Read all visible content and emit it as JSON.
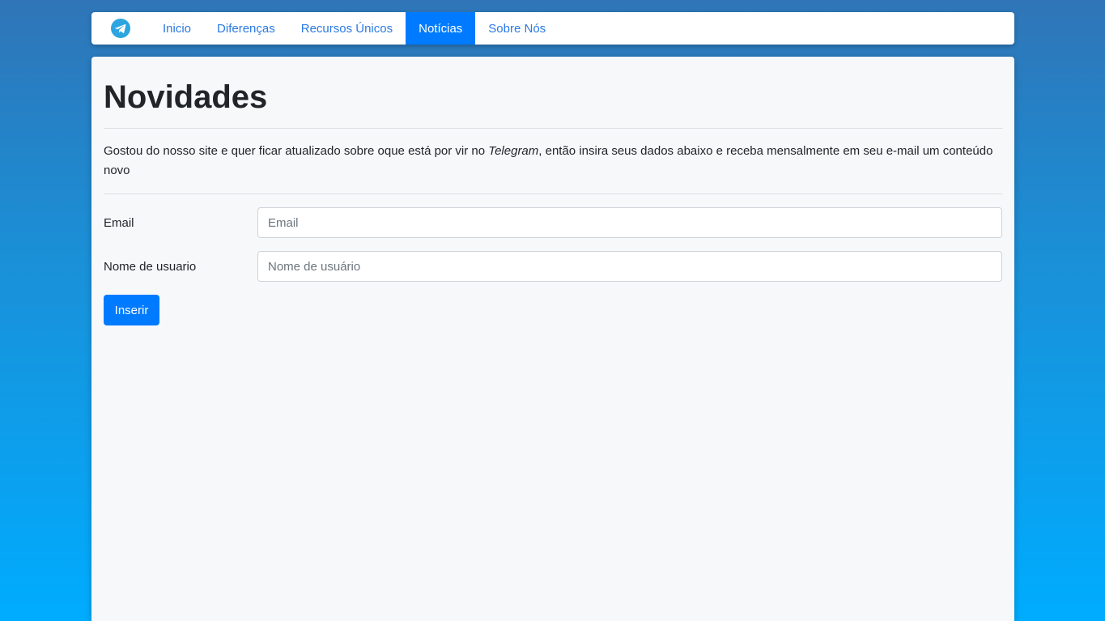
{
  "nav": {
    "brand_icon": "telegram-icon",
    "items": [
      {
        "label": "Inicio",
        "active": false
      },
      {
        "label": "Diferenças",
        "active": false
      },
      {
        "label": "Recursos Únicos",
        "active": false
      },
      {
        "label": "Notícias",
        "active": true
      },
      {
        "label": "Sobre Nós",
        "active": false
      }
    ]
  },
  "main": {
    "title": "Novidades",
    "intro_before": "Gostou do nosso site e quer ficar atualizado sobre oque está por vir no ",
    "intro_emphasis": "Telegram",
    "intro_after": ", então insira seus dados abaixo e receba mensalmente em seu e-mail um conteúdo novo"
  },
  "form": {
    "email_label": "Email",
    "email_placeholder": "Email",
    "email_value": "",
    "username_label": "Nome de usuario",
    "username_placeholder": "Nome de usuário",
    "username_value": "",
    "submit_label": "Inserir"
  },
  "colors": {
    "primary": "#007bff",
    "link": "#2a7ae2",
    "telegram_blue": "#2ca5e0",
    "background_top": "#2f75b7",
    "background_bottom": "#00acff"
  }
}
